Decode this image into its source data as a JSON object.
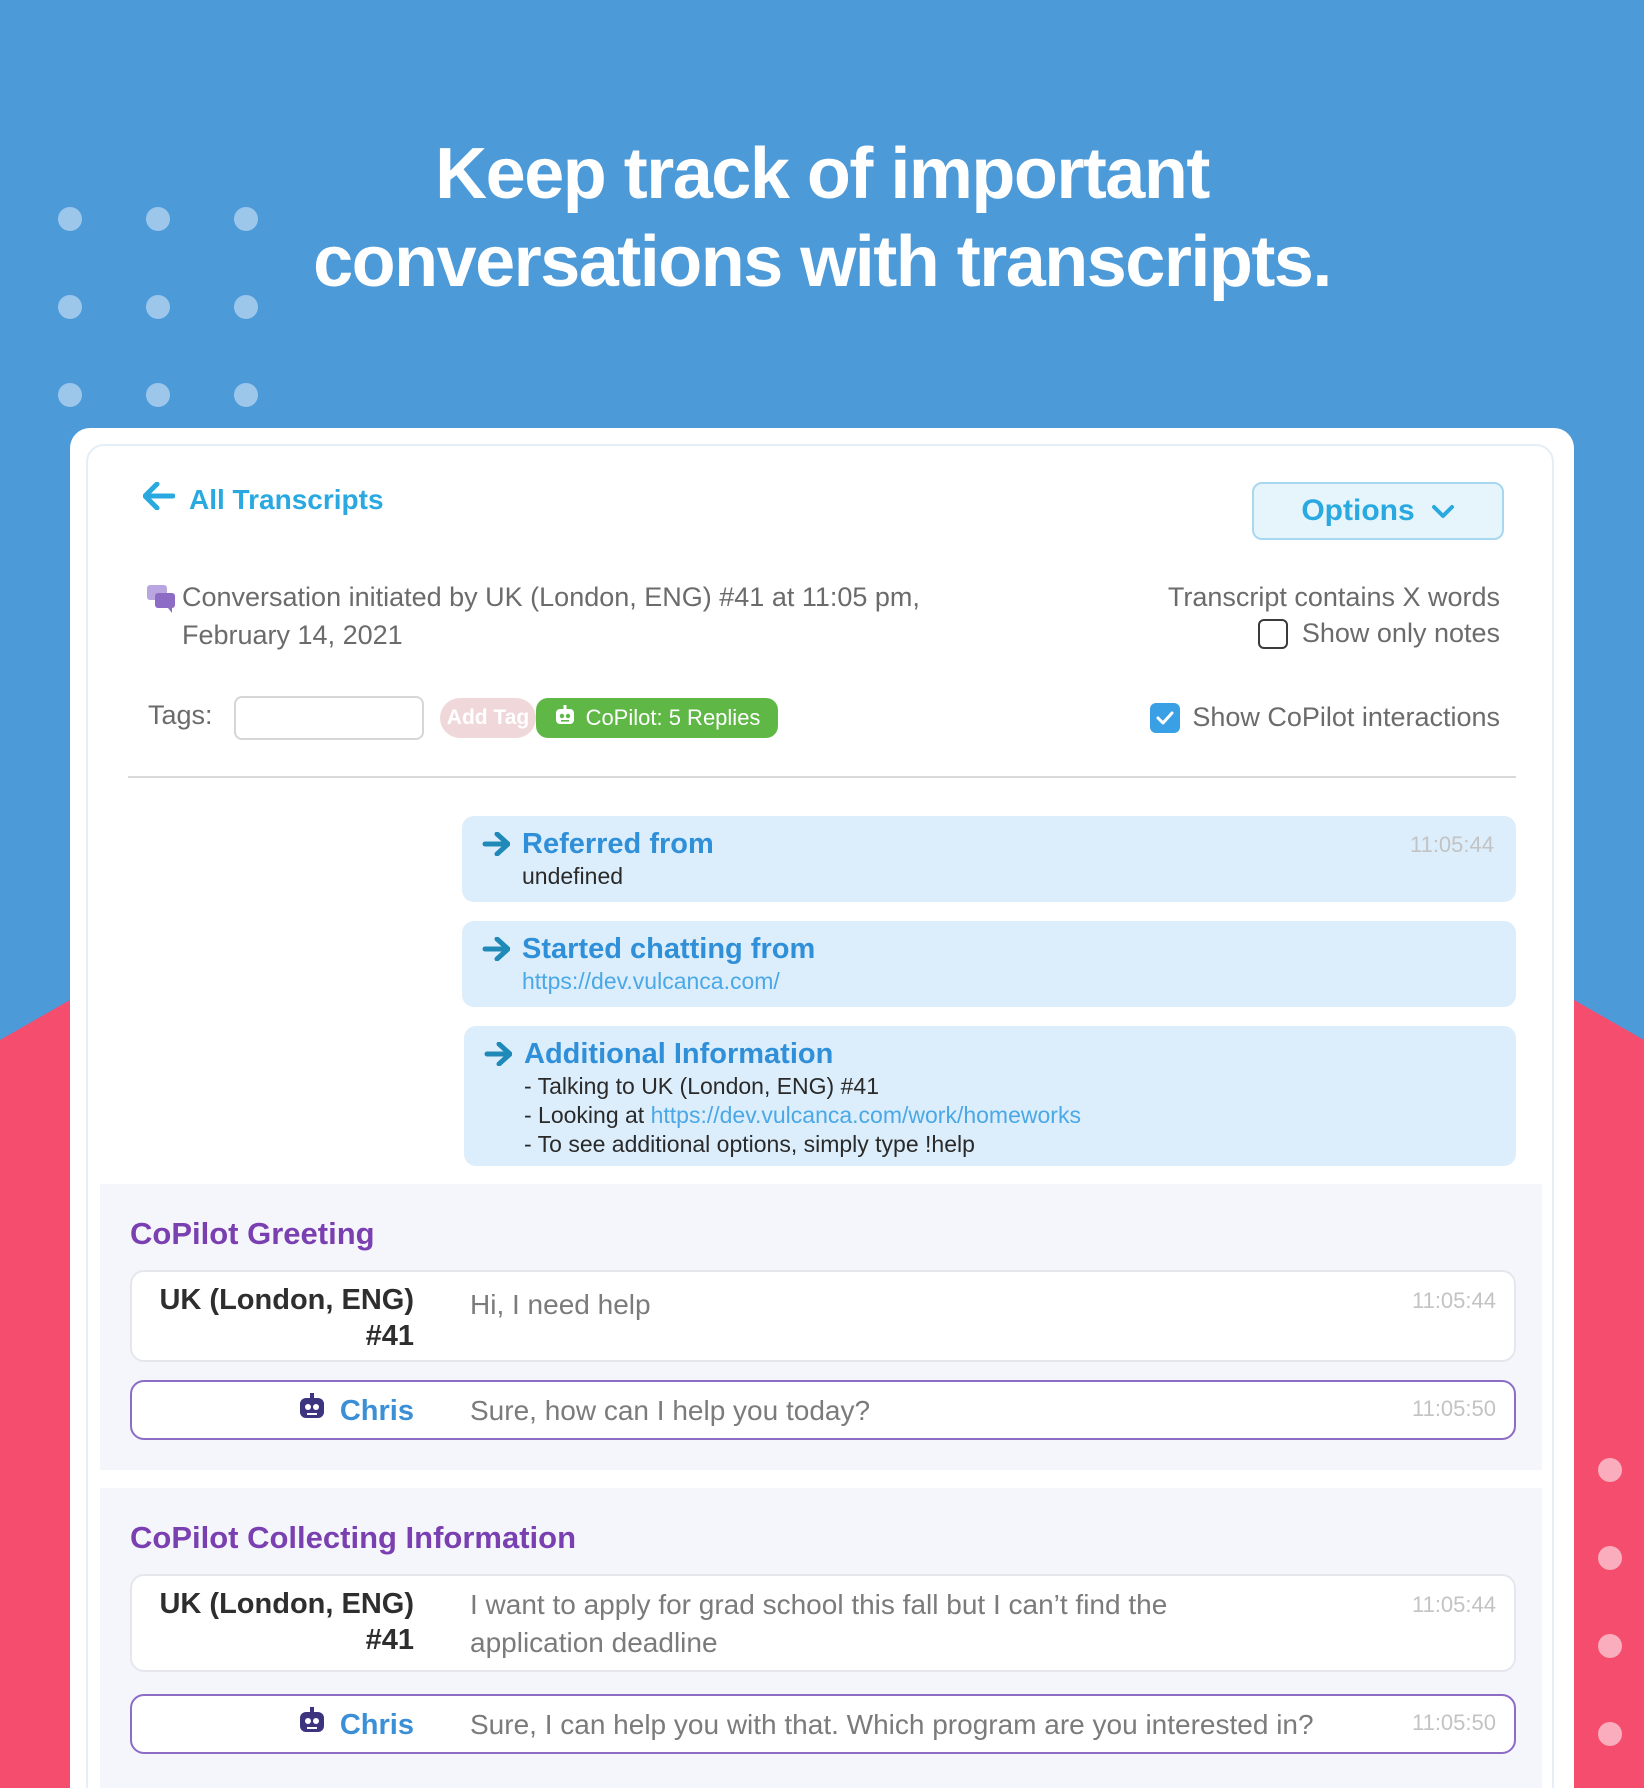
{
  "headline": {
    "line1": "Keep track of important",
    "line2": "conversations with transcripts."
  },
  "header": {
    "back_label": "All Transcripts",
    "options_label": "Options"
  },
  "conversation": {
    "line1": "Conversation initiated by UK (London, ENG) #41 at 11:05 pm,",
    "line2": "February 14, 2021",
    "word_count_text": "Transcript contains X words",
    "show_notes_label": "Show only notes",
    "show_copilot_label": "Show CoPilot interactions"
  },
  "tags": {
    "label": "Tags:",
    "input_value": "",
    "add_tag_label": "Add Tag",
    "copilot_badge": "CoPilot: 5 Replies"
  },
  "info_boxes": [
    {
      "title": "Referred from",
      "body": "undefined",
      "time": "11:05:44"
    },
    {
      "title": "Started chatting from",
      "link": "https://dev.vulcanca.com/"
    },
    {
      "title": "Additional Information",
      "line1": "- Talking to UK (London, ENG) #41",
      "line2_prefix": "- Looking at ",
      "line2_link": "https://dev.vulcanca.com/work/homeworks",
      "line3": "- To see additional options, simply type !help"
    }
  ],
  "sections": [
    {
      "title": "CoPilot Greeting",
      "messages": [
        {
          "sender_line1": "UK (London, ENG)",
          "sender_line2": "#41",
          "text": "Hi, I need help",
          "time": "11:05:44"
        },
        {
          "sender": "Chris",
          "text": "Sure, how can I help you today?",
          "time": "11:05:50"
        }
      ]
    },
    {
      "title": "CoPilot Collecting Information",
      "messages": [
        {
          "sender_line1": "UK (London, ENG)",
          "sender_line2": "#41",
          "text": "I want to apply for grad school this fall but I can’t find the application deadline",
          "time": "11:05:44"
        },
        {
          "sender": "Chris",
          "text": "Sure, I can help you with that. Which program are you interested in?",
          "time": "11:05:50"
        }
      ]
    }
  ],
  "colors": {
    "background_blue": "#4d9ad9",
    "background_pink": "#f44d6e",
    "accent_blue": "#29a9e0",
    "section_purple": "#7a3fb0",
    "badge_green": "#5fb846"
  }
}
